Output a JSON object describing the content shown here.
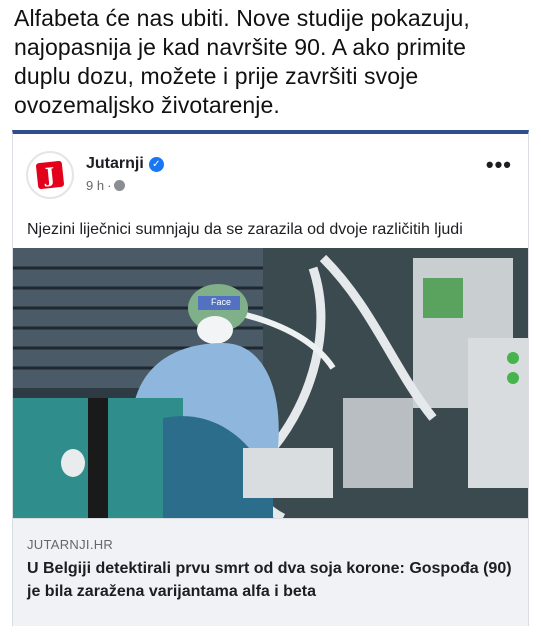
{
  "caption": "Alfabeta će nas ubiti. Nove studije pokazuju, najopasnija je kad navršite 90. A ako primite duplu dozu, možete i prije završiti svoje ovozemaljsko životarenje.",
  "post": {
    "page_name": "Jutarnji",
    "logo_letter": "J",
    "time": "9 h",
    "separator": "·",
    "more_label": "•••",
    "text": "Njezini liječnici sumnjaju da se zarazila od dvoje različitih ljudi",
    "photo_label": "Face",
    "link": {
      "domain": "JUTARNJI.HR",
      "title": "U Belgiji detektirali prvu smrt od dva soja korone: Gospođa (90) je bila zaražena varijantama alfa i beta"
    }
  },
  "colors": {
    "brand_red": "#e2001a",
    "verified_blue": "#1877f2",
    "preview_bg": "#f0f2f5"
  }
}
